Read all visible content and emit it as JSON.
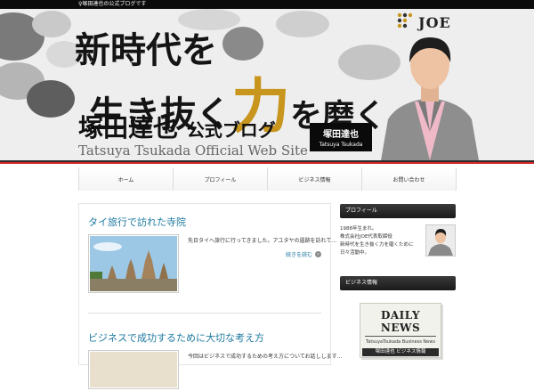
{
  "topbar": {
    "text": "♀塚田達也の公式ブログです"
  },
  "banner": {
    "logo": "JOE",
    "headline_line1": "新時代を",
    "headline_line2_a": "生き抜く",
    "headline_line2_b": "力",
    "headline_line2_c": "を磨く",
    "name_jp": "塚田達也",
    "name_jp_suffix": "公式ブログ",
    "name_en": "Tatsuya Tsukada Official Web Site",
    "card_jp": "塚田達也",
    "card_en": "Tatsuya Tsukada"
  },
  "nav": [
    {
      "label": "ホーム"
    },
    {
      "label": "プロフィール"
    },
    {
      "label": "ビジネス情報"
    },
    {
      "label": "お問い合わせ"
    }
  ],
  "posts": [
    {
      "title": "タイ旅行で訪れた寺院",
      "excerpt": "先日タイへ旅行に行ってきました。アユタヤの遺跡を訪れて…",
      "more": "続きを読む"
    },
    {
      "title": "ビジネスで成功するために大切な考え方",
      "excerpt": "今回はビジネスで成功するための考え方についてお話しします…",
      "more": ""
    }
  ],
  "sidebar": {
    "profile_title": "プロフィール",
    "profile_lines": [
      "1988年生まれ。",
      "株式会社JOE代表取締役",
      "新時代を生き抜く力を磨くために",
      "日々活動中。"
    ],
    "news_title": "ビジネス情報",
    "news_paper_title": "DAILY NEWS",
    "news_paper_sub": "TatsuyaTsukada Business News",
    "news_paper_band": "塚田達也 ビジネス情報"
  },
  "colors": {
    "accent": "#d62828",
    "link": "#1e7aa0",
    "gold": "#c8951d"
  }
}
